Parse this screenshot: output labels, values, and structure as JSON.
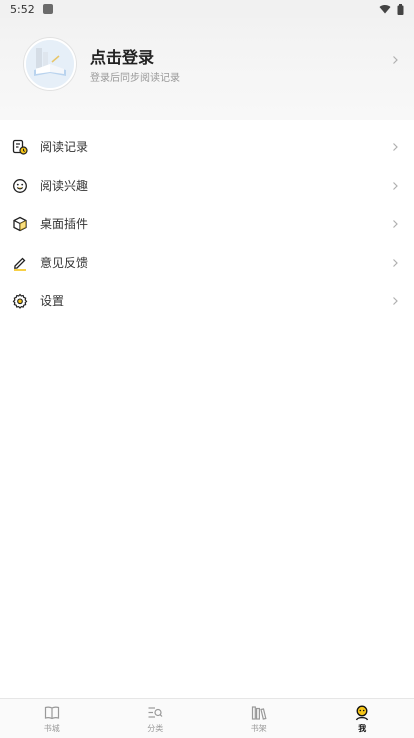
{
  "status_bar": {
    "time": "5:52"
  },
  "header": {
    "title": "点击登录",
    "subtitle": "登录后同步阅读记录"
  },
  "menu": {
    "items": [
      {
        "label": "阅读记录",
        "icon": "reading-history-icon"
      },
      {
        "label": "阅读兴趣",
        "icon": "smiley-icon"
      },
      {
        "label": "桌面插件",
        "icon": "cube-icon"
      },
      {
        "label": "意见反馈",
        "icon": "pencil-icon"
      },
      {
        "label": "设置",
        "icon": "gear-icon"
      }
    ]
  },
  "bottom_nav": {
    "items": [
      {
        "label": "书城",
        "icon": "book-icon",
        "active": false
      },
      {
        "label": "分类",
        "icon": "category-search-icon",
        "active": false
      },
      {
        "label": "书架",
        "icon": "bookshelf-icon",
        "active": false
      },
      {
        "label": "我",
        "icon": "profile-icon",
        "active": true
      }
    ]
  },
  "colors": {
    "accent": "#f5c518",
    "header_bg": "#f3f3f3",
    "text": "#333333",
    "muted": "#999999"
  }
}
